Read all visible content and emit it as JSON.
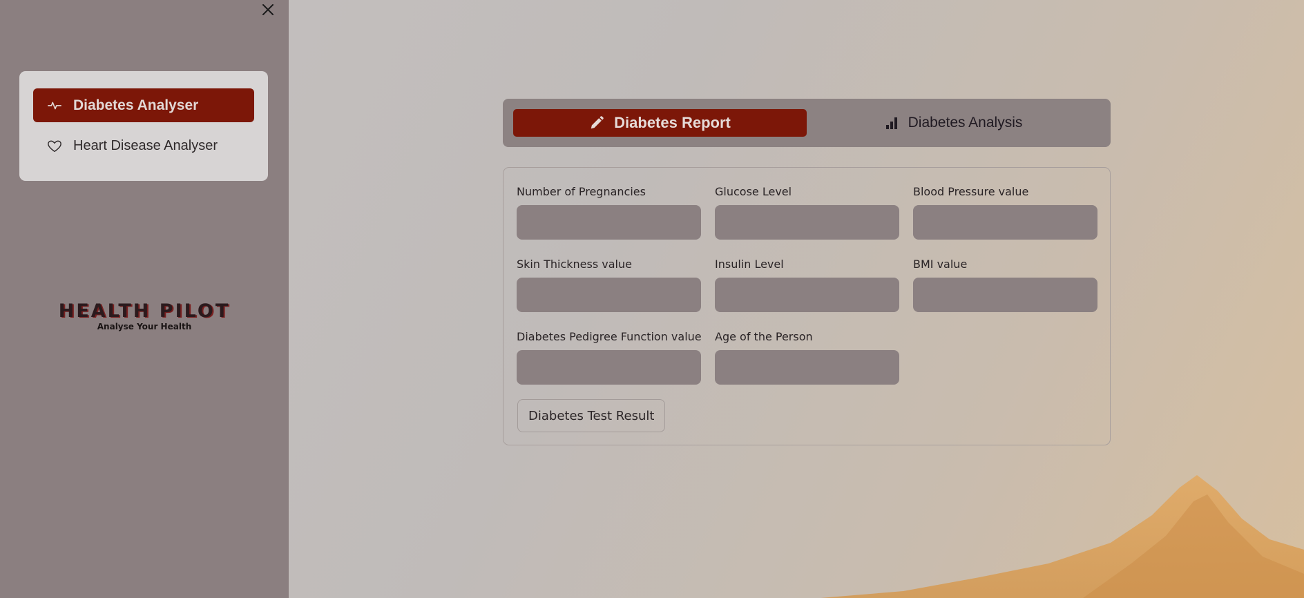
{
  "sidebar": {
    "close_icon": "close-icon",
    "nav": [
      {
        "label": "Diabetes Analyser",
        "icon": "activity-icon",
        "active": true
      },
      {
        "label": "Heart Disease Analyser",
        "icon": "heart-icon",
        "active": false
      }
    ],
    "brand": {
      "title": "HEALTH PILOT",
      "subtitle": "Analyse Your Health"
    }
  },
  "tabs": [
    {
      "label": "Diabetes Report",
      "icon": "pencil-icon",
      "active": true
    },
    {
      "label": "Diabetes Analysis",
      "icon": "bar-chart-icon",
      "active": false
    }
  ],
  "form": {
    "fields": [
      {
        "label": "Number of Pregnancies",
        "value": ""
      },
      {
        "label": "Glucose Level",
        "value": ""
      },
      {
        "label": "Blood Pressure value",
        "value": ""
      },
      {
        "label": "Skin Thickness value",
        "value": ""
      },
      {
        "label": "Insulin Level",
        "value": ""
      },
      {
        "label": "BMI value",
        "value": ""
      },
      {
        "label": "Diabetes Pedigree Function value",
        "value": ""
      },
      {
        "label": "Age of the Person",
        "value": ""
      }
    ],
    "submit_label": "Diabetes Test Result"
  },
  "colors": {
    "accent": "#7c1708",
    "sidebar_bg": "#8b7f80",
    "input_bg": "#8b8081"
  }
}
